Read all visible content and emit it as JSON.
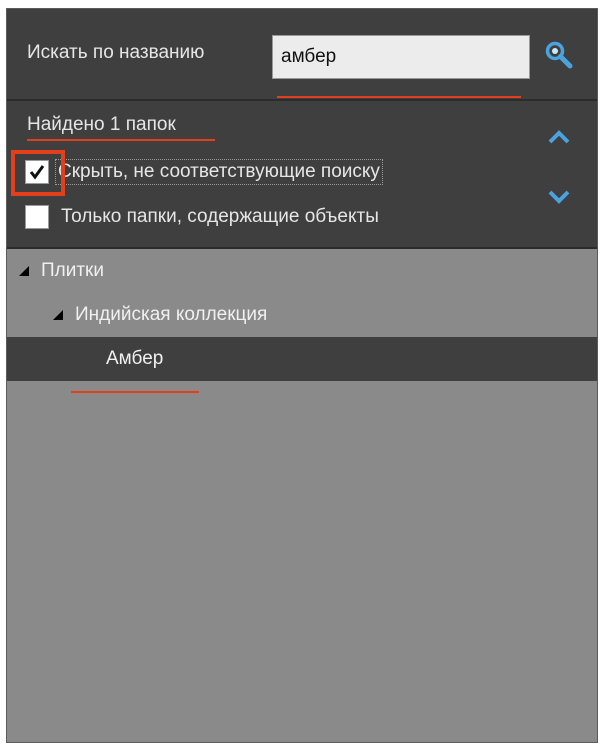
{
  "search": {
    "label": "Искать по названию",
    "value": "амбер"
  },
  "results": {
    "found_label": "Найдено 1 папок"
  },
  "options": {
    "hide_nonmatching": {
      "label": "Скрыть, не соответствующие поиску",
      "checked": true
    },
    "only_with_objects": {
      "label": "Только папки, содержащие объекты",
      "checked": false
    }
  },
  "tree": {
    "items": [
      {
        "label": "Плитки",
        "level": 0,
        "expanded": true,
        "selected": false
      },
      {
        "label": "Индийская коллекция",
        "level": 1,
        "expanded": true,
        "selected": false
      },
      {
        "label": "Амбер",
        "level": 2,
        "expanded": false,
        "selected": true
      }
    ]
  },
  "colors": {
    "accent": "#4aa3df",
    "highlight": "#e2401c",
    "panel": "#3f3f3f",
    "tree_background": "#8a8a8a"
  },
  "icons": {
    "search": "magnifier-icon",
    "up": "chevron-up-icon",
    "down": "chevron-down-icon"
  }
}
